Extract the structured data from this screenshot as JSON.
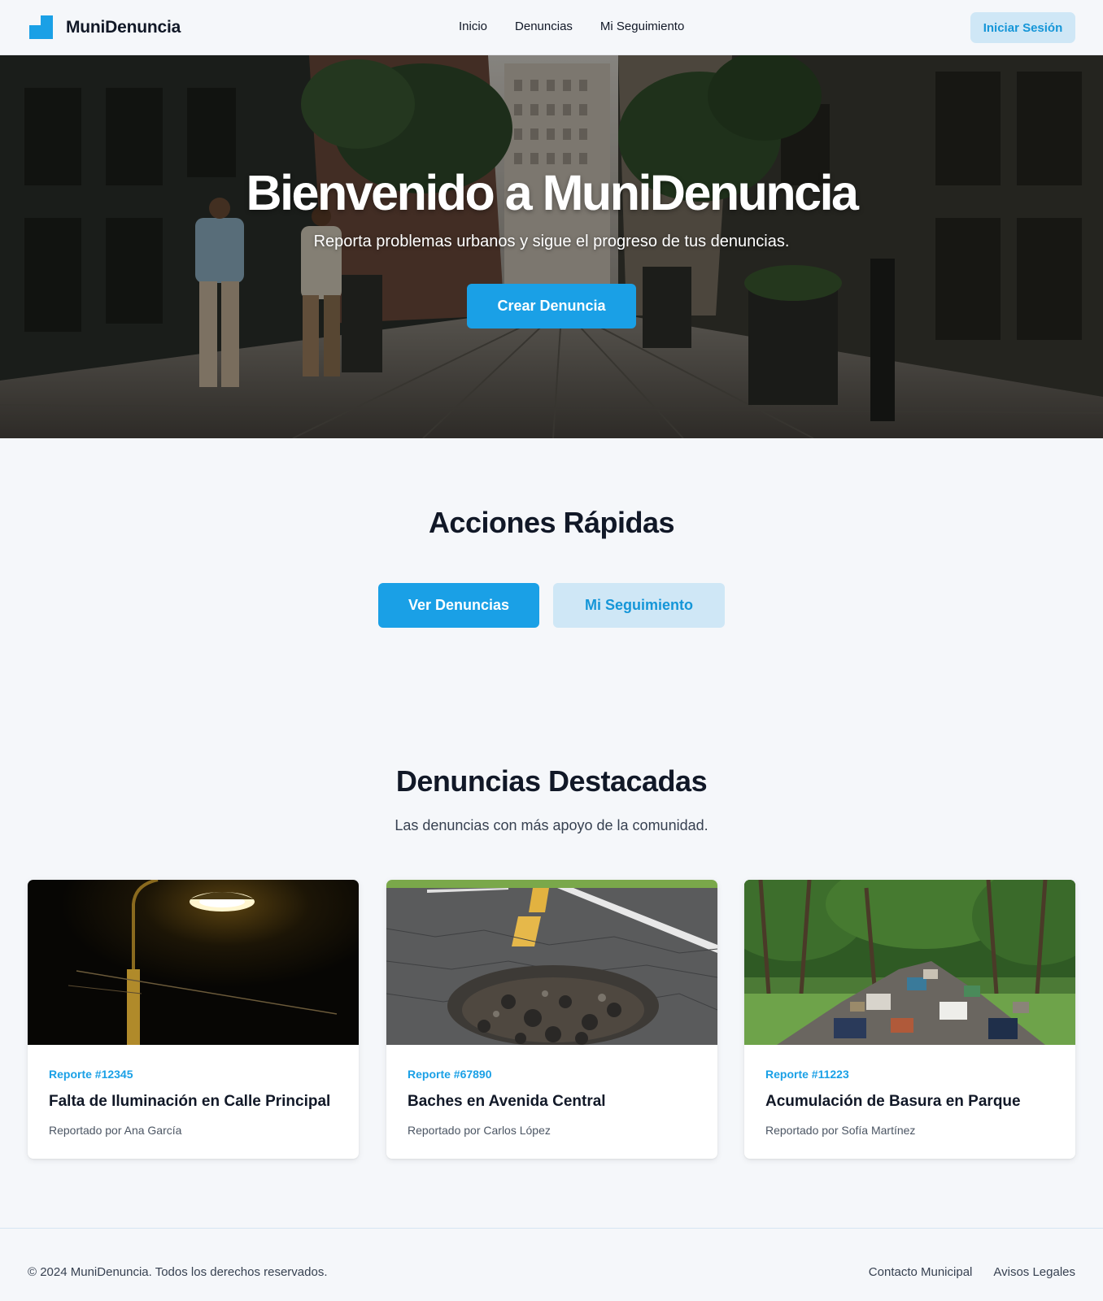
{
  "header": {
    "brand": "MuniDenuncia",
    "nav": [
      "Inicio",
      "Denuncias",
      "Mi Seguimiento"
    ],
    "login_label": "Iniciar Sesión",
    "accent": "#1aa0e6"
  },
  "hero": {
    "title": "Bienvenido a MuniDenuncia",
    "subtitle": "Reporta problemas urbanos y sigue el progreso de tus denuncias.",
    "cta": "Crear Denuncia"
  },
  "quick_actions": {
    "title": "Acciones Rápidas",
    "primary": "Ver Denuncias",
    "secondary": "Mi Seguimiento"
  },
  "featured": {
    "title": "Denuncias Destacadas",
    "subtitle": "Las denuncias con más apoyo de la comunidad.",
    "cards": [
      {
        "code": "Reporte #12345",
        "title": "Falta de Iluminación en Calle Principal",
        "author": "Reportado por Ana García",
        "image": "street-lamp-night"
      },
      {
        "code": "Reporte #67890",
        "title": "Baches en Avenida Central",
        "author": "Reportado por Carlos López",
        "image": "road-pothole"
      },
      {
        "code": "Reporte #11223",
        "title": "Acumulación de Basura en Parque",
        "author": "Reportado por Sofía Martínez",
        "image": "garbage-pile-park"
      }
    ]
  },
  "footer": {
    "copyright": "© 2024 MuniDenuncia. Todos los derechos reservados.",
    "links": [
      "Contacto Municipal",
      "Avisos Legales"
    ]
  }
}
